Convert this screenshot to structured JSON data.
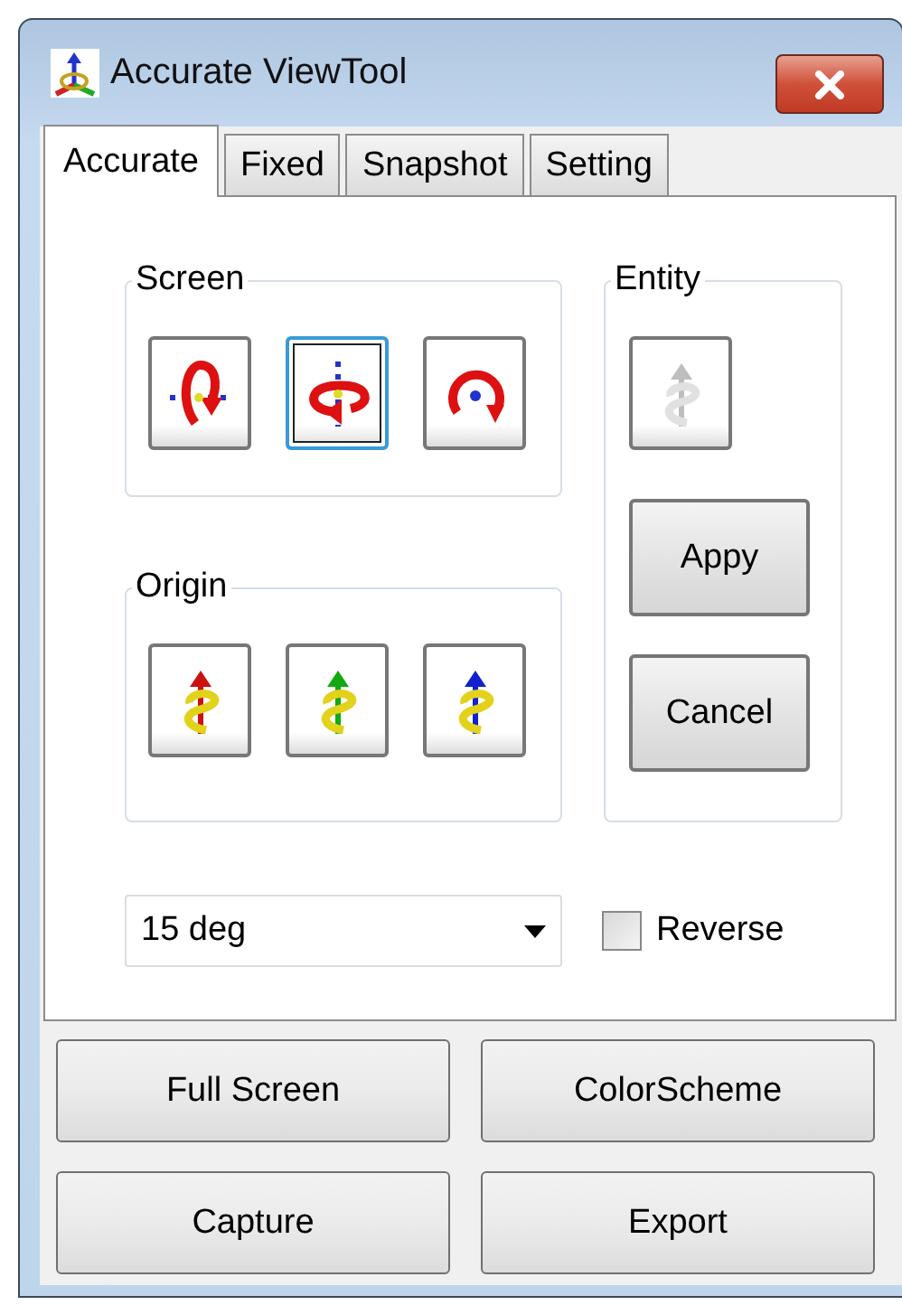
{
  "window": {
    "title": "Accurate ViewTool"
  },
  "tabs": [
    {
      "label": "Accurate",
      "selected": true
    },
    {
      "label": "Fixed",
      "selected": false
    },
    {
      "label": "Snapshot",
      "selected": false
    },
    {
      "label": "Setting",
      "selected": false
    }
  ],
  "screen_group": {
    "label": "Screen",
    "buttons": [
      {
        "kind": "vertical",
        "focused": false
      },
      {
        "kind": "horizontal",
        "focused": true
      },
      {
        "kind": "planar",
        "focused": false
      }
    ]
  },
  "origin_group": {
    "label": "Origin",
    "buttons": [
      {
        "color": "#cc1111"
      },
      {
        "color": "#11aa11"
      },
      {
        "color": "#1122cc"
      }
    ]
  },
  "entity_group": {
    "label": "Entity",
    "icon_button": {
      "disabled": true
    },
    "buttons": [
      "Appy",
      "Cancel"
    ]
  },
  "angle_select": {
    "value": "15 deg"
  },
  "reverse_checkbox": {
    "label": "Reverse",
    "checked": false
  },
  "buttons": [
    "Full Screen",
    "ColorScheme",
    "Capture",
    "Export"
  ]
}
